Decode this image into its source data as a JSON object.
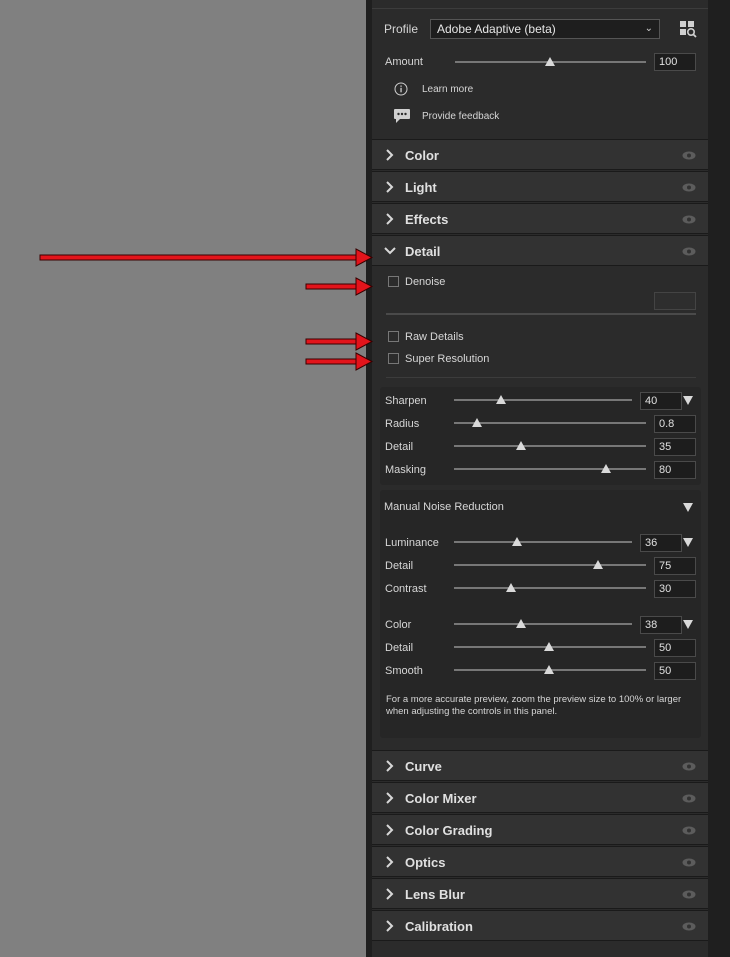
{
  "profile": {
    "label": "Profile",
    "value": "Adobe Adaptive (beta)",
    "amount_label": "Amount",
    "amount_value": "100",
    "amount": 100,
    "learn_more": "Learn more",
    "provide_feedback": "Provide feedback"
  },
  "sections_top": [
    {
      "title": "Color"
    },
    {
      "title": "Light"
    },
    {
      "title": "Effects"
    }
  ],
  "detail": {
    "title": "Detail",
    "denoise_label": "Denoise",
    "raw_details_label": "Raw Details",
    "super_resolution_label": "Super Resolution",
    "sharpen": {
      "sliders": [
        {
          "label": "Sharpen",
          "value": "40"
        },
        {
          "label": "Radius",
          "value": "0.8"
        },
        {
          "label": "Detail",
          "value": "35"
        },
        {
          "label": "Masking",
          "value": "80"
        }
      ]
    },
    "noise": {
      "title": "Manual Noise Reduction",
      "luminance": [
        {
          "label": "Luminance",
          "value": "36"
        },
        {
          "label": "Detail",
          "value": "75"
        },
        {
          "label": "Contrast",
          "value": "30"
        }
      ],
      "color": [
        {
          "label": "Color",
          "value": "38"
        },
        {
          "label": "Detail",
          "value": "50"
        },
        {
          "label": "Smooth",
          "value": "50"
        }
      ],
      "note": "For a more accurate preview, zoom the preview size to 100% or larger when adjusting the controls in this panel."
    }
  },
  "sections_bottom": [
    {
      "title": "Curve"
    },
    {
      "title": "Color Mixer"
    },
    {
      "title": "Color Grading"
    },
    {
      "title": "Optics"
    },
    {
      "title": "Lens Blur"
    },
    {
      "title": "Calibration"
    }
  ],
  "colors": {
    "arrow": "#e3141b",
    "panel": "#2b2b2b",
    "background": "#808080"
  }
}
